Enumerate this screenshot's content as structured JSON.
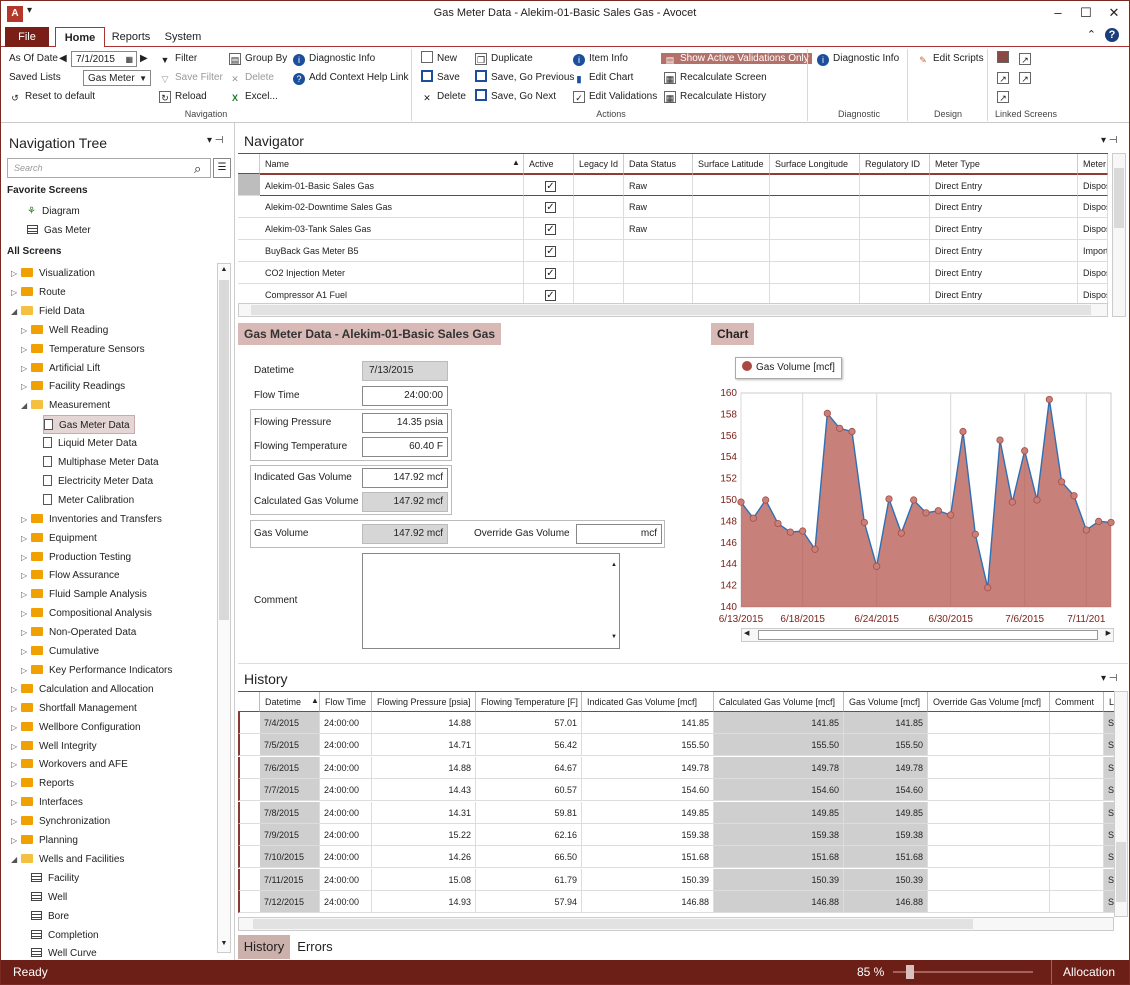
{
  "window": {
    "title": "Gas Meter Data - Alekim-01-Basic Sales Gas - Avocet",
    "quick_access": "▾"
  },
  "tabs": {
    "file": "File",
    "home": "Home",
    "reports": "Reports",
    "system": "System"
  },
  "ribbon": {
    "as_of_date_label": "As Of Date",
    "as_of_date_value": "7/1/2015",
    "saved_lists_label": "Saved Lists",
    "saved_lists_value": "Gas Meter",
    "reset_default": "Reset to default",
    "filter": "Filter",
    "save_filter": "Save Filter",
    "reload": "Reload",
    "group_by": "Group By",
    "delete_gray": "Delete",
    "excel": "Excel...",
    "diagnostic_info": "Diagnostic Info",
    "add_help_link": "Add Context Help Link",
    "group_navigation": "Navigation",
    "new": "New",
    "save": "Save",
    "delete": "Delete",
    "duplicate": "Duplicate",
    "save_go_previous": "Save, Go Previous",
    "save_go_next": "Save, Go Next",
    "item_info": "Item Info",
    "edit_chart": "Edit Chart",
    "edit_validations": "Edit Validations",
    "show_active_validations": "Show Active Validations Only",
    "recalculate_screen": "Recalculate Screen",
    "recalculate_history": "Recalculate History",
    "group_actions": "Actions",
    "diag_info2": "Diagnostic Info",
    "group_diagnostic": "Diagnostic",
    "edit_scripts": "Edit Scripts",
    "group_design": "Design",
    "group_linked": "Linked Screens"
  },
  "nav": {
    "title": "Navigation Tree",
    "search_placeholder": "Search",
    "favorites_header": "Favorite Screens",
    "fav_diagram": "Diagram",
    "fav_gas_meter": "Gas Meter",
    "all_header": "All Screens",
    "items": [
      {
        "label": "Visualization",
        "level": 1,
        "arrow": "▷",
        "icon": "folder"
      },
      {
        "label": "Route",
        "level": 1,
        "arrow": "▷",
        "icon": "folder"
      },
      {
        "label": "Field Data",
        "level": 1,
        "arrow": "◢",
        "icon": "folder-open"
      },
      {
        "label": "Well Reading",
        "level": 2,
        "arrow": "▷",
        "icon": "folder"
      },
      {
        "label": "Temperature Sensors",
        "level": 2,
        "arrow": "▷",
        "icon": "folder"
      },
      {
        "label": "Artificial Lift",
        "level": 2,
        "arrow": "▷",
        "icon": "folder"
      },
      {
        "label": "Facility Readings",
        "level": 2,
        "arrow": "▷",
        "icon": "folder"
      },
      {
        "label": "Measurement",
        "level": 2,
        "arrow": "◢",
        "icon": "folder-open"
      },
      {
        "label": "Gas Meter Data",
        "level": 3,
        "arrow": "",
        "icon": "doc"
      },
      {
        "label": "Liquid Meter Data",
        "level": 3,
        "arrow": "",
        "icon": "doc"
      },
      {
        "label": "Multiphase Meter Data",
        "level": 3,
        "arrow": "",
        "icon": "doc"
      },
      {
        "label": "Electricity Meter Data",
        "level": 3,
        "arrow": "",
        "icon": "doc"
      },
      {
        "label": "Meter Calibration",
        "level": 3,
        "arrow": "",
        "icon": "doc"
      },
      {
        "label": "Inventories and Transfers",
        "level": 2,
        "arrow": "▷",
        "icon": "folder"
      },
      {
        "label": "Equipment",
        "level": 2,
        "arrow": "▷",
        "icon": "folder"
      },
      {
        "label": "Production Testing",
        "level": 2,
        "arrow": "▷",
        "icon": "folder"
      },
      {
        "label": "Flow Assurance",
        "level": 2,
        "arrow": "▷",
        "icon": "folder"
      },
      {
        "label": "Fluid Sample Analysis",
        "level": 2,
        "arrow": "▷",
        "icon": "folder"
      },
      {
        "label": "Compositional Analysis",
        "level": 2,
        "arrow": "▷",
        "icon": "folder"
      },
      {
        "label": "Non-Operated Data",
        "level": 2,
        "arrow": "▷",
        "icon": "folder"
      },
      {
        "label": "Cumulative",
        "level": 2,
        "arrow": "▷",
        "icon": "folder"
      },
      {
        "label": "Key Performance Indicators",
        "level": 2,
        "arrow": "▷",
        "icon": "folder"
      },
      {
        "label": "Calculation and Allocation",
        "level": 1,
        "arrow": "▷",
        "icon": "folder"
      },
      {
        "label": "Shortfall Management",
        "level": 1,
        "arrow": "▷",
        "icon": "folder"
      },
      {
        "label": "Wellbore Configuration",
        "level": 1,
        "arrow": "▷",
        "icon": "folder"
      },
      {
        "label": "Well Integrity",
        "level": 1,
        "arrow": "▷",
        "icon": "folder"
      },
      {
        "label": "Workovers and AFE",
        "level": 1,
        "arrow": "▷",
        "icon": "folder"
      },
      {
        "label": "Reports",
        "level": 1,
        "arrow": "▷",
        "icon": "folder"
      },
      {
        "label": "Interfaces",
        "level": 1,
        "arrow": "▷",
        "icon": "folder"
      },
      {
        "label": "Synchronization",
        "level": 1,
        "arrow": "▷",
        "icon": "folder"
      },
      {
        "label": "Planning",
        "level": 1,
        "arrow": "▷",
        "icon": "folder"
      },
      {
        "label": "Wells and Facilities",
        "level": 1,
        "arrow": "◢",
        "icon": "folder-open"
      },
      {
        "label": "Facility",
        "level": 2,
        "arrow": "",
        "icon": "table"
      },
      {
        "label": "Well",
        "level": 2,
        "arrow": "",
        "icon": "table"
      },
      {
        "label": "Bore",
        "level": 2,
        "arrow": "",
        "icon": "table"
      },
      {
        "label": "Completion",
        "level": 2,
        "arrow": "",
        "icon": "table"
      },
      {
        "label": "Well Curve",
        "level": 2,
        "arrow": "",
        "icon": "table"
      }
    ]
  },
  "navigator": {
    "title": "Navigator",
    "columns": [
      "Name",
      "Active",
      "Legacy Id",
      "Data Status",
      "Surface Latitude",
      "Surface Longitude",
      "Regulatory ID",
      "Meter Type",
      "Meter t"
    ],
    "rows": [
      [
        "Alekim-01-Basic Sales Gas",
        "✓",
        "",
        "Raw",
        "",
        "",
        "",
        "Direct Entry",
        "Disposi"
      ],
      [
        "Alekim-02-Downtime Sales Gas",
        "✓",
        "",
        "Raw",
        "",
        "",
        "",
        "Direct Entry",
        "Disposi"
      ],
      [
        "Alekim-03-Tank Sales Gas",
        "✓",
        "",
        "Raw",
        "",
        "",
        "",
        "Direct Entry",
        "Disposi"
      ],
      [
        "BuyBack Gas Meter B5",
        "✓",
        "",
        "",
        "",
        "",
        "",
        "Direct Entry",
        "Import"
      ],
      [
        "CO2 Injection Meter",
        "✓",
        "",
        "",
        "",
        "",
        "",
        "Direct Entry",
        "Disposi"
      ],
      [
        "Compressor A1  Fuel",
        "✓",
        "",
        "",
        "",
        "",
        "",
        "Direct Entry",
        "Disposi"
      ]
    ]
  },
  "form": {
    "title": "Gas Meter Data - Alekim-01-Basic Sales Gas",
    "datetime_label": "Datetime",
    "datetime_value": "7/13/2015",
    "flow_time_label": "Flow Time",
    "flow_time_value": "24:00:00",
    "flowing_pressure_label": "Flowing Pressure",
    "flowing_pressure_value": "14.35 psia",
    "flowing_temp_label": "Flowing Temperature",
    "flowing_temp_value": "60.40 F",
    "indicated_gas_label": "Indicated Gas Volume",
    "indicated_gas_value": "147.92 mcf",
    "calculated_gas_label": "Calculated Gas Volume",
    "calculated_gas_value": "147.92 mcf",
    "gas_volume_label": "Gas Volume",
    "gas_volume_value": "147.92 mcf",
    "override_label": "Override Gas Volume",
    "override_value": "mcf",
    "comment_label": "Comment"
  },
  "chart_panel_title": "Chart",
  "chart_data": {
    "type": "area",
    "legend": "Gas Volume [mcf]",
    "x_ticks": [
      "6/13/2015",
      "6/18/2015",
      "6/24/2015",
      "6/30/2015",
      "7/6/2015",
      "7/11/201"
    ],
    "y_ticks": [
      "140",
      "142",
      "144",
      "146",
      "148",
      "150",
      "152",
      "154",
      "156",
      "158",
      "160"
    ],
    "ylim": [
      140,
      160
    ],
    "x": [
      "6/13",
      "6/14",
      "6/15",
      "6/16",
      "6/17",
      "6/18",
      "6/19",
      "6/20",
      "6/21",
      "6/22",
      "6/23",
      "6/24",
      "6/25",
      "6/26",
      "6/27",
      "6/28",
      "6/29",
      "6/30",
      "7/1",
      "7/2",
      "7/3",
      "7/4",
      "7/5",
      "7/6",
      "7/7",
      "7/8",
      "7/9",
      "7/10",
      "7/11",
      "7/12",
      "7/13"
    ],
    "values": [
      149.8,
      148.3,
      150.0,
      147.8,
      147.0,
      147.1,
      145.4,
      158.1,
      156.7,
      156.4,
      147.9,
      143.8,
      150.1,
      146.9,
      150.0,
      148.8,
      149.0,
      148.6,
      156.4,
      146.8,
      141.8,
      155.6,
      149.8,
      154.6,
      150.0,
      159.4,
      151.7,
      150.4,
      147.2,
      148.0,
      147.9
    ],
    "color": "#b5564e"
  },
  "history": {
    "title": "History",
    "columns": [
      "Datetime",
      "Flow Time",
      "Flowing Pressure [psia]",
      "Flowing Temperature [F]",
      "Indicated Gas Volume [mcf]",
      "Calculated Gas Volume [mcf]",
      "Gas Volume [mcf]",
      "Override Gas Volume [mcf]",
      "Comment",
      "L"
    ],
    "rows": [
      [
        "7/4/2015",
        "24:00:00",
        "14.88",
        "57.01",
        "141.85",
        "141.85",
        "141.85",
        "",
        "",
        "S"
      ],
      [
        "7/5/2015",
        "24:00:00",
        "14.71",
        "56.42",
        "155.50",
        "155.50",
        "155.50",
        "",
        "",
        "S"
      ],
      [
        "7/6/2015",
        "24:00:00",
        "14.88",
        "64.67",
        "149.78",
        "149.78",
        "149.78",
        "",
        "",
        "S"
      ],
      [
        "7/7/2015",
        "24:00:00",
        "14.43",
        "60.57",
        "154.60",
        "154.60",
        "154.60",
        "",
        "",
        "S"
      ],
      [
        "7/8/2015",
        "24:00:00",
        "14.31",
        "59.81",
        "149.85",
        "149.85",
        "149.85",
        "",
        "",
        "S"
      ],
      [
        "7/9/2015",
        "24:00:00",
        "15.22",
        "62.16",
        "159.38",
        "159.38",
        "159.38",
        "",
        "",
        "S"
      ],
      [
        "7/10/2015",
        "24:00:00",
        "14.26",
        "66.50",
        "151.68",
        "151.68",
        "151.68",
        "",
        "",
        "S"
      ],
      [
        "7/11/2015",
        "24:00:00",
        "15.08",
        "61.79",
        "150.39",
        "150.39",
        "150.39",
        "",
        "",
        "S"
      ],
      [
        "7/12/2015",
        "24:00:00",
        "14.93",
        "57.94",
        "146.88",
        "146.88",
        "146.88",
        "",
        "",
        "S"
      ]
    ]
  },
  "bottom_tabs": {
    "history": "History",
    "errors": "Errors"
  },
  "status": {
    "ready": "Ready",
    "zoom": "85 %",
    "mode": "Allocation"
  }
}
